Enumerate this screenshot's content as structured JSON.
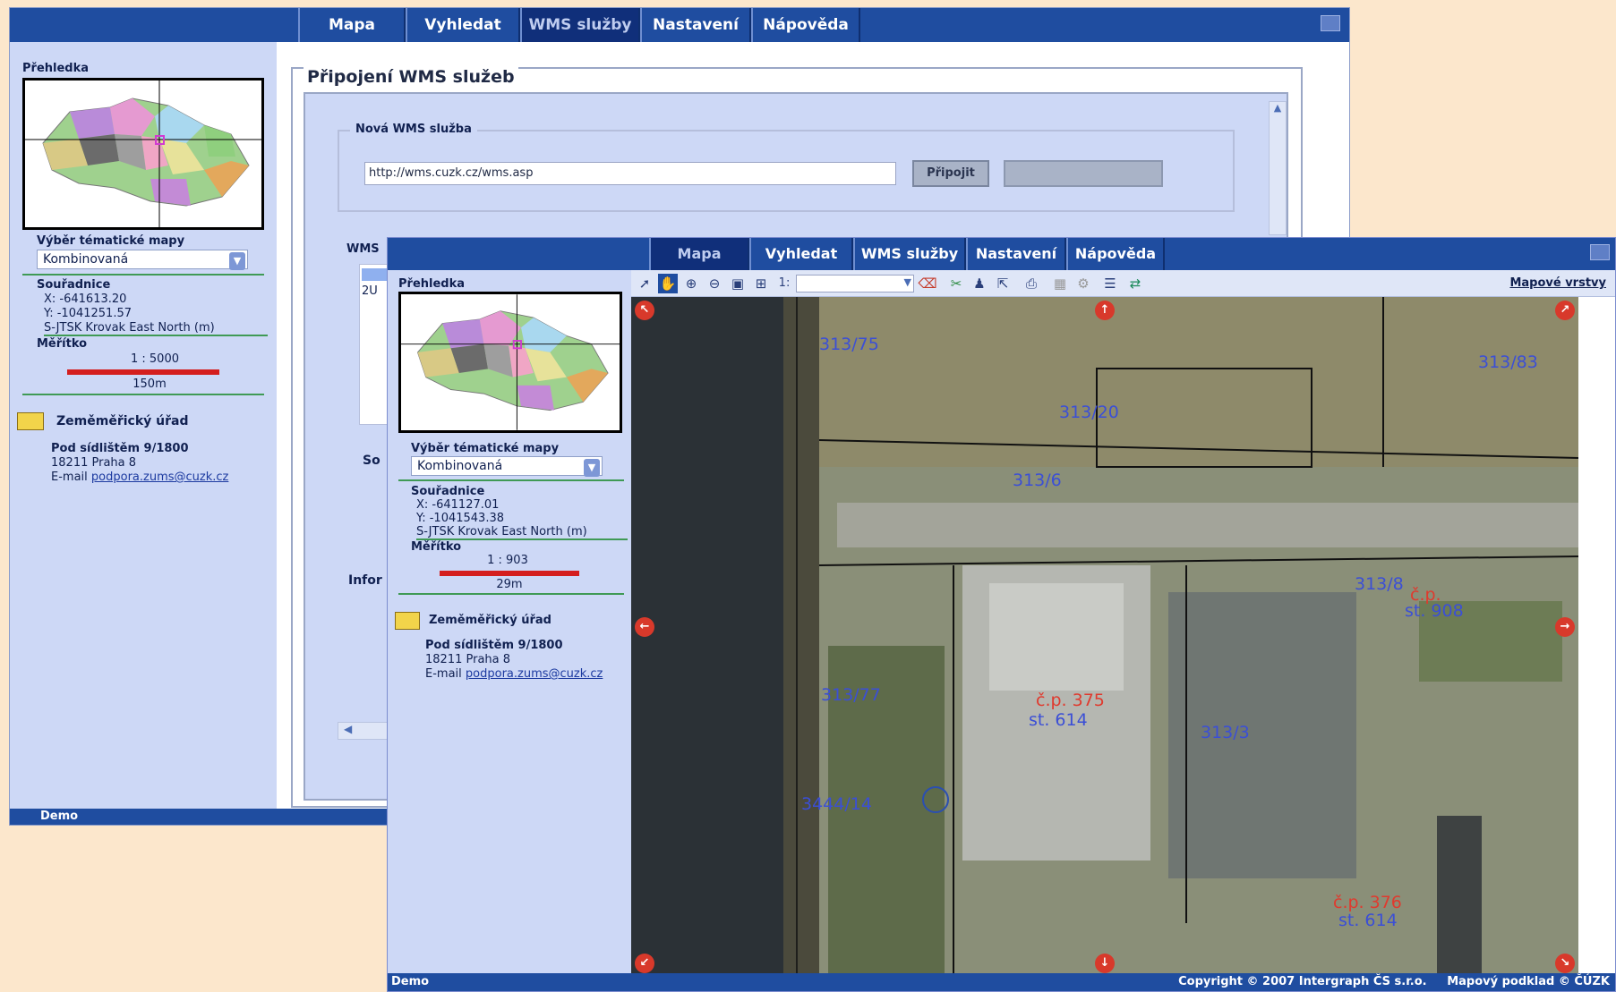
{
  "back_window": {
    "tabs": [
      "Mapa",
      "Vyhledat",
      "WMS služby",
      "Nastavení",
      "Nápověda"
    ],
    "active_tab": "WMS služby",
    "sidebar": {
      "overview_title": "Přehledka",
      "thematic_title": "Výběr tématické mapy",
      "thematic_value": "Kombinovaná",
      "coords_title": "Souřadnice",
      "coord_x": "X: -641613.20",
      "coord_y": "Y: -1041251.57",
      "coord_system": "S-JTSK Krovak East North (m)",
      "scale_title": "Měřítko",
      "scale_value": "1 : 5000",
      "scale_bar_label": "150m",
      "office_title": "Zeměměřický úřad",
      "address_line1": "Pod sídlištěm 9/1800",
      "address_line2": "18211 Praha 8",
      "email_prefix": "E-mail",
      "email_link": "podpora.zums@cuzk.cz"
    },
    "panel": {
      "title": "Připojení WMS služeb",
      "new_service_legend": "Nová WMS služba",
      "url_value": "http://wms.cuzk.cz/wms.asp",
      "connect_button": "Připojit",
      "wms_legend_fragment": "WMS",
      "list_fragment": "2U",
      "so_fragment": "So",
      "info_fragment": "Infor"
    },
    "status": "Demo"
  },
  "front_window": {
    "tabs": [
      "Mapa",
      "Vyhledat",
      "WMS služby",
      "Nastavení",
      "Nápověda"
    ],
    "active_tab": "Mapa",
    "toolbar": {
      "scale_prefix": "1:",
      "layers_link": "Mapové vrstvy"
    },
    "sidebar": {
      "overview_title": "Přehledka",
      "thematic_title": "Výběr tématické mapy",
      "thematic_value": "Kombinovaná",
      "coords_title": "Souřadnice",
      "coord_x": "X: -641127.01",
      "coord_y": "Y: -1041543.38",
      "coord_system": "S-JTSK Krovak East North (m)",
      "scale_title": "Měřítko",
      "scale_value": "1 : 903",
      "scale_bar_label": "29m",
      "office_title": "Zeměměřický úřad",
      "address_line1": "Pod sídlištěm 9/1800",
      "address_line2": "18211 Praha 8",
      "email_prefix": "E-mail",
      "email_link": "podpora.zums@cuzk.cz"
    },
    "map_labels": {
      "parcel_1": "313/75",
      "parcel_2": "313/83",
      "parcel_3": "313/20",
      "parcel_4": "313/6",
      "parcel_5": "313/77",
      "parcel_6": "313/3",
      "parcel_7": "3444/14",
      "parcel_8": "313/8",
      "parcel_9": "st. 614",
      "parcel_10": "st. 908",
      "parcel_11": "st. 614",
      "cp_1": "č.p. 375",
      "cp_2": "č.p.",
      "cp_3": "č.p. 376"
    },
    "status_left": "Demo",
    "status_right": "Copyright © 2007 Intergraph ČS s.r.o.     Mapový podklad © ČÚZK"
  },
  "colors": {
    "tabbar": "#1f4da0",
    "sidebar": "#cdd8f6",
    "desktop": "#fce7cc",
    "parcel_label": "#3b4fd6",
    "cp_label": "#e03a2e"
  }
}
